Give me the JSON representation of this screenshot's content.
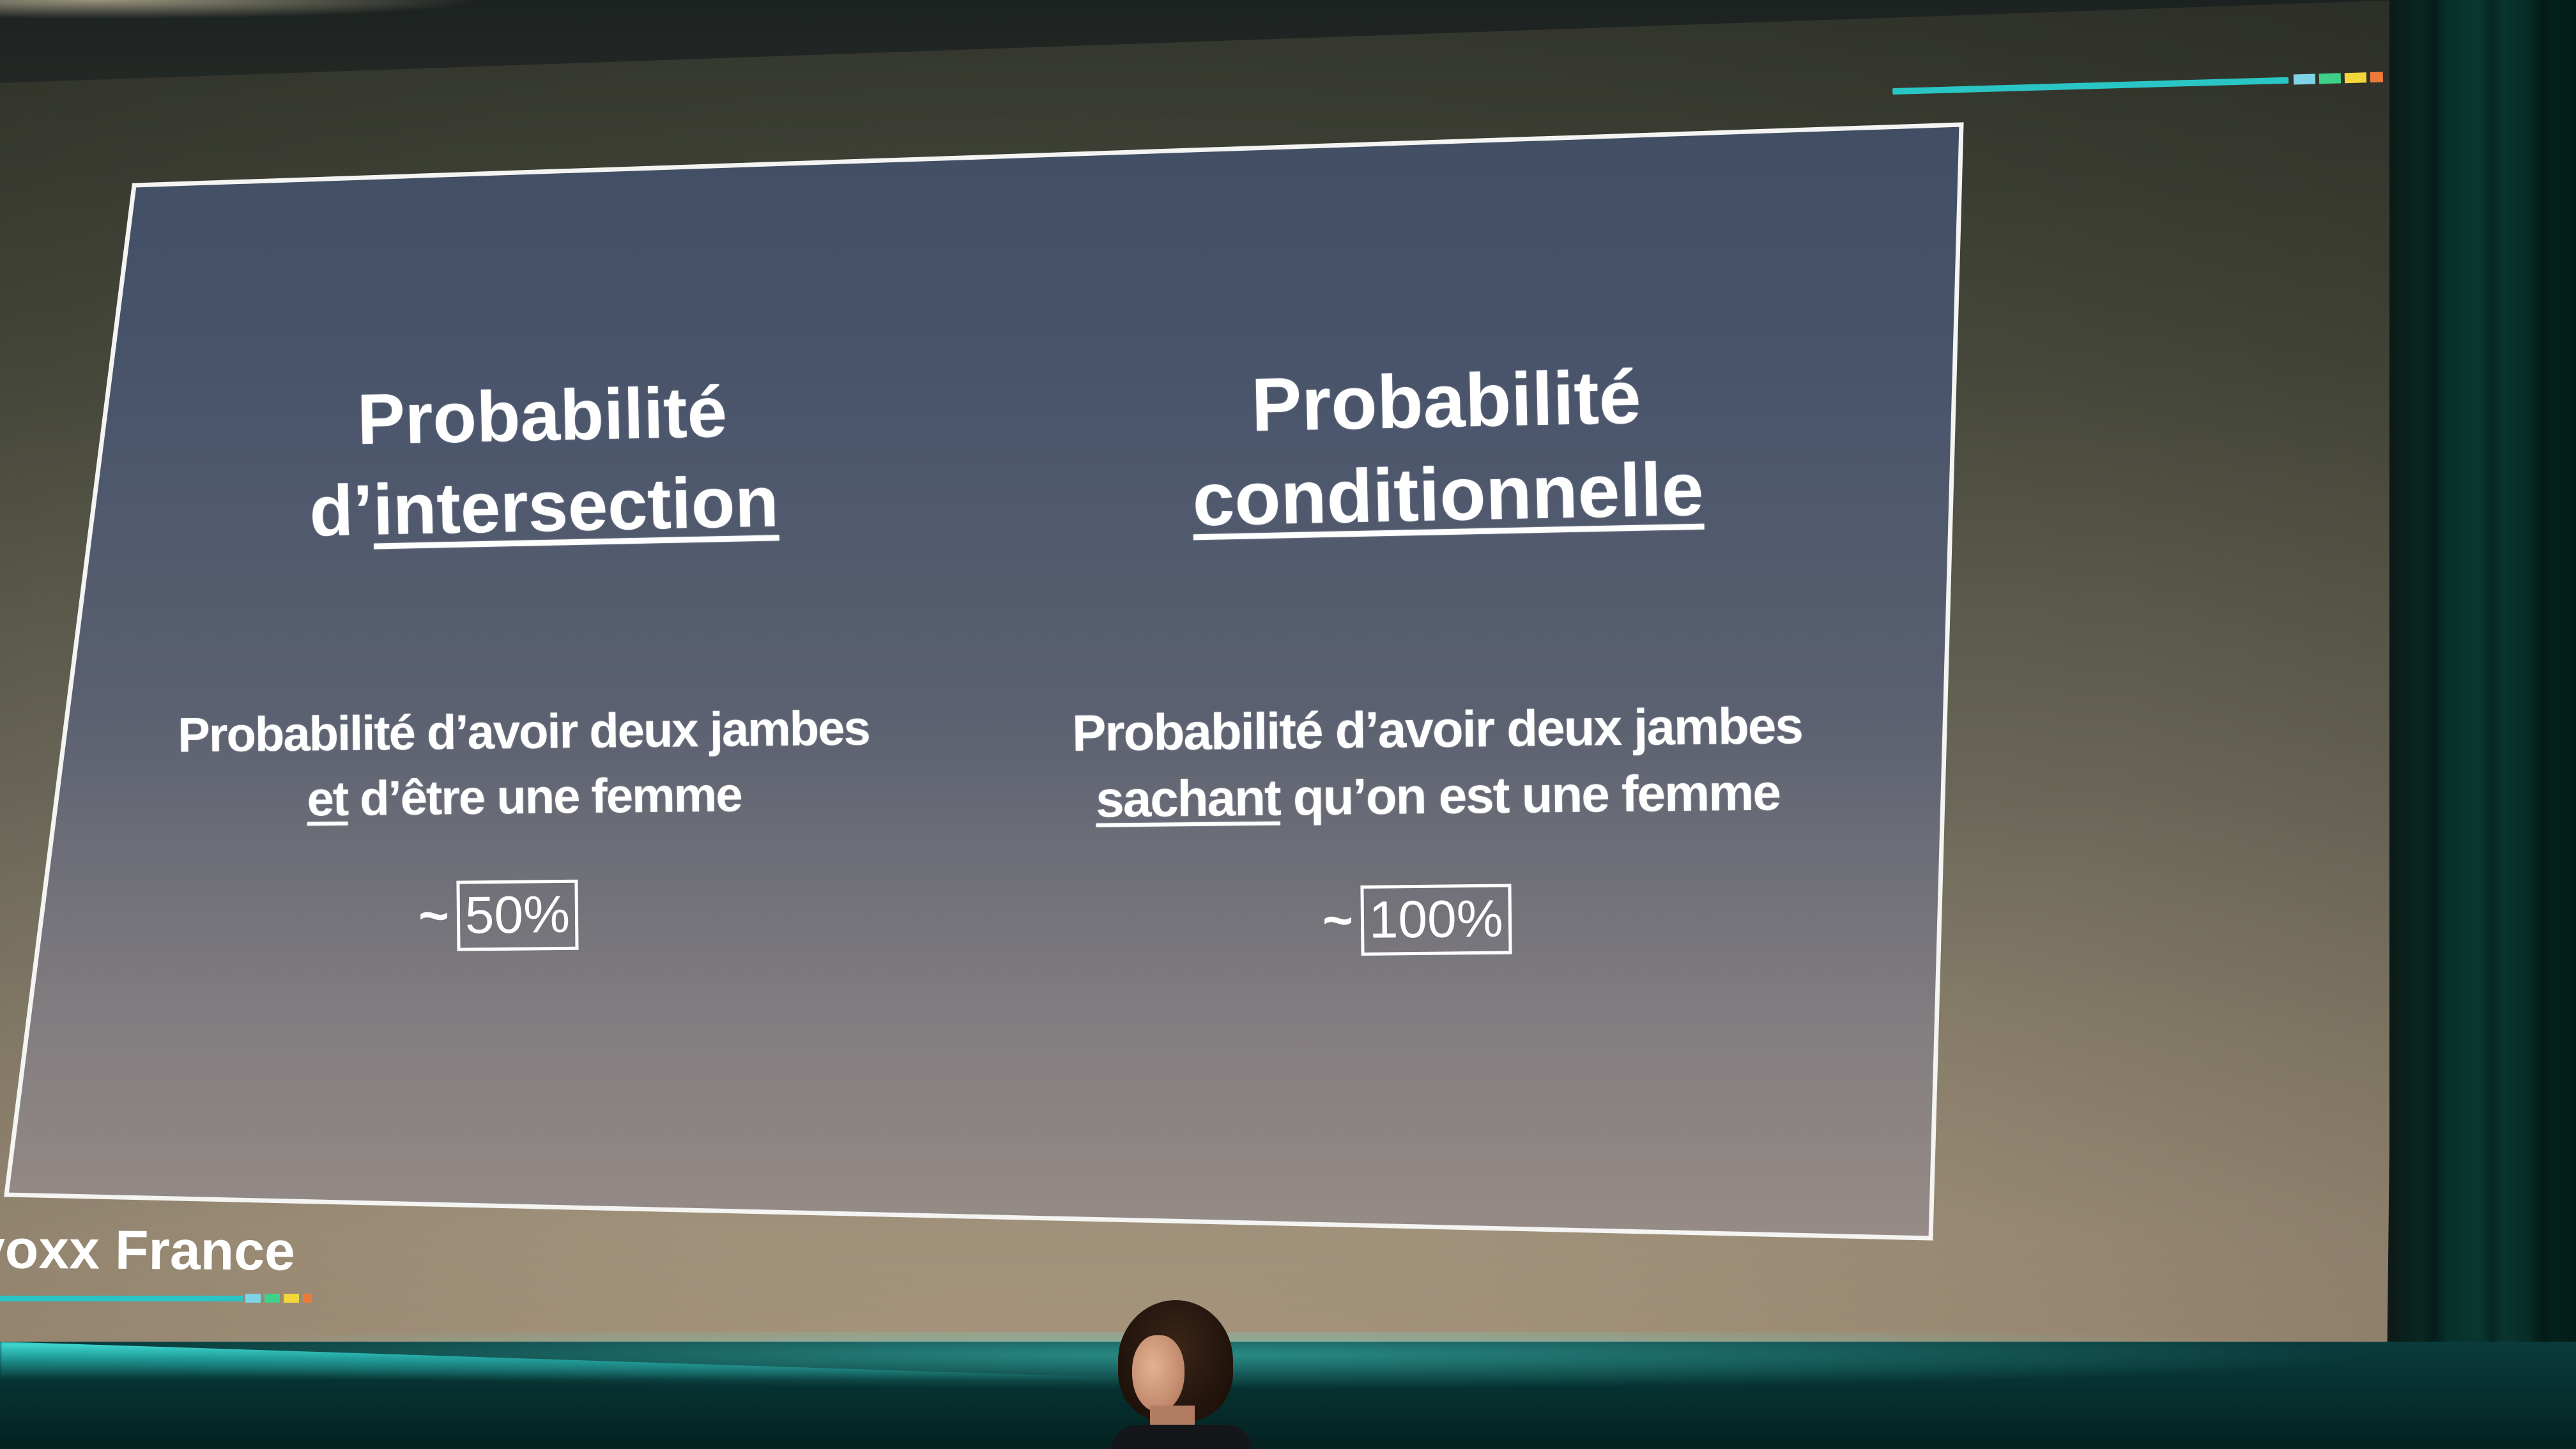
{
  "slide": {
    "left_column": {
      "title_line1": "Probabilité",
      "title_prefix": "d’",
      "title_underlined": "intersection",
      "desc_line1": "Probabilité d’avoir deux jambes",
      "desc_underlined": "et",
      "desc_rest": " d’être une femme",
      "tilde": "~",
      "percent": "50%"
    },
    "right_column": {
      "title_line1": "Probabilité",
      "title_underlined": "conditionnelle",
      "desc_line1": "Probabilité d’avoir deux jambes",
      "desc_underlined": "sachant",
      "desc_rest": " qu’on est une femme",
      "tilde": "~",
      "percent": "100%"
    }
  },
  "branding": {
    "logo_text": "voxx France",
    "colors": {
      "teal": "#2ac6c5",
      "green": "#3fd08a",
      "yellow": "#f2d63a",
      "orange": "#ee7a3a",
      "light_blue": "#7fd3e6"
    }
  }
}
